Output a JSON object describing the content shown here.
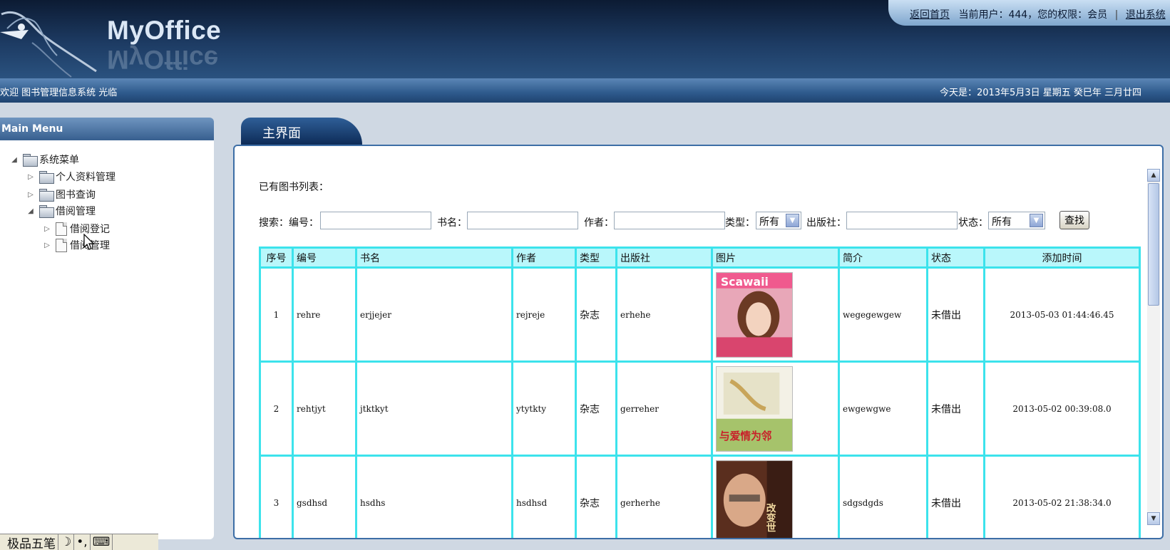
{
  "header": {
    "logo_text": "MyOffice",
    "top_links": {
      "home_link": "返回首页",
      "current_user": "当前用户：444，您的权限：会员",
      "sep": "|",
      "logout_link": "退出系统"
    }
  },
  "welcome_bar": {
    "welcome_text": "欢迎 图书管理信息系统 光临",
    "date_text": "今天是：2013年5月3日 星期五 癸巳年 三月廿四"
  },
  "side_menu": {
    "title": "Main Menu",
    "tree": {
      "root": "系统菜单",
      "items": [
        "个人资料管理",
        "图书查询",
        "借阅管理"
      ],
      "children": [
        "借阅登记",
        "借阅管理"
      ]
    }
  },
  "main": {
    "tab_label": "主界面",
    "list_title": "已有图书列表：",
    "search": {
      "search_label": "搜索：",
      "id_label": "编号：",
      "name_label": "书名：",
      "author_label": "作者：",
      "type_label": "类型：",
      "type_value": "所有",
      "publisher_label": "出版社：",
      "status_label": "状态：",
      "status_value": "所有",
      "find_button": "查找",
      "id_value": "",
      "name_value": "",
      "author_value": "",
      "publisher_value": ""
    },
    "table": {
      "columns": [
        "序号",
        "编号",
        "书名",
        "作者",
        "类型",
        "出版社",
        "图片",
        "简介",
        "状态",
        "添加时间"
      ],
      "rows": [
        {
          "seq": "1",
          "id": "rehre",
          "name": "erjjejer",
          "author": "rejreje",
          "type": "杂志",
          "publisher": "erhehe",
          "intro": "wegegewgew",
          "status": "未借出",
          "time": "2013-05-03 01:44:46.45"
        },
        {
          "seq": "2",
          "id": "rehtjyt",
          "name": "jtktkyt",
          "author": "ytytkty",
          "type": "杂志",
          "publisher": "gerreher",
          "intro": "ewgewgwe",
          "status": "未借出",
          "time": "2013-05-02 00:39:08.0"
        },
        {
          "seq": "3",
          "id": "gsdhsd",
          "name": "hsdhs",
          "author": "hsdhsd",
          "type": "杂志",
          "publisher": "gerherhe",
          "intro": "sdgsdgds",
          "status": "未借出",
          "time": "2013-05-02 21:38:34.0"
        }
      ],
      "cover_texts": [
        "Scawaii",
        "与爱情为邻",
        "改变世"
      ]
    }
  },
  "ime_bar": {
    "label": "极品五笔",
    "moon": "☽",
    "dots": "•,",
    "keyboard": "⌨"
  },
  "colors": {
    "header_dark": "#0c1b33",
    "table_border": "#3ce3ec",
    "table_header_bg": "#b9f7fb",
    "panel_border": "#3d6ea6"
  }
}
